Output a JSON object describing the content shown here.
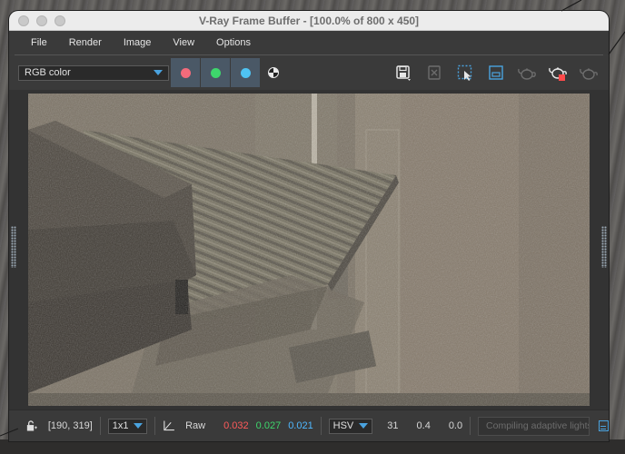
{
  "window": {
    "title": "V-Ray Frame Buffer - [100.0% of 800 x 450]"
  },
  "menu": {
    "items": [
      {
        "label": "File"
      },
      {
        "label": "Render"
      },
      {
        "label": "Image"
      },
      {
        "label": "View"
      },
      {
        "label": "Options"
      }
    ]
  },
  "toolbar": {
    "channel_select": "RGB color",
    "channels": [
      {
        "name": "red-channel",
        "color": "#f36b7b"
      },
      {
        "name": "green-channel",
        "color": "#3ed66c"
      },
      {
        "name": "blue-channel",
        "color": "#4fc3f2"
      }
    ],
    "icons": [
      "monochrome-icon",
      "save-icon",
      "clear-image-icon",
      "region-render-icon",
      "render-region-icon",
      "teapot-icon",
      "stop-render-icon",
      "teapot-outline-icon"
    ]
  },
  "status": {
    "coords": "[190, 319]",
    "sample_size": "1x1",
    "mode_label": "Raw",
    "r": "0.032",
    "g": "0.027",
    "b": "0.021",
    "colorspace": "HSV",
    "h": "31",
    "s": "0.4",
    "v": "0.0",
    "progress_text": "Compiling adaptive lights..."
  },
  "colors": {
    "accent": "#4aa3df",
    "red_value": "#ff5a5a",
    "green_value": "#3ed66c",
    "blue_value": "#4fb8ff"
  }
}
